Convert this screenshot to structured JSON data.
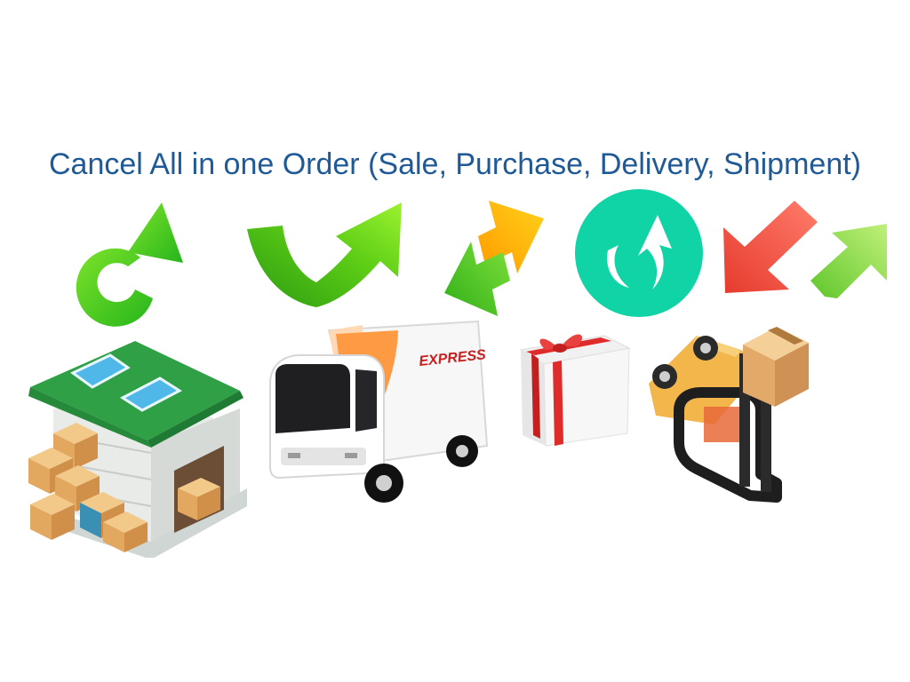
{
  "slide": {
    "title": "Cancel All in one Order (Sale, Purchase, Delivery, Shipment)",
    "accent_color": "#1f5a96"
  },
  "icons": {
    "refresh_arrow": "circular-refresh-arrow-icon",
    "curved_up_arrow": "curved-up-arrow-icon",
    "exchange_arrows": "exchange-arrows-icon",
    "circular_undo": "circular-undo-arrow-icon",
    "red_down_left": "down-left-arrow-icon",
    "green_up_right": "up-right-arrow-icon",
    "warehouse": "warehouse-icon",
    "truck": "delivery-truck-icon",
    "gift": "gift-box-icon",
    "forklift": "forklift-icon"
  },
  "truck": {
    "label": "EXPRESS"
  }
}
